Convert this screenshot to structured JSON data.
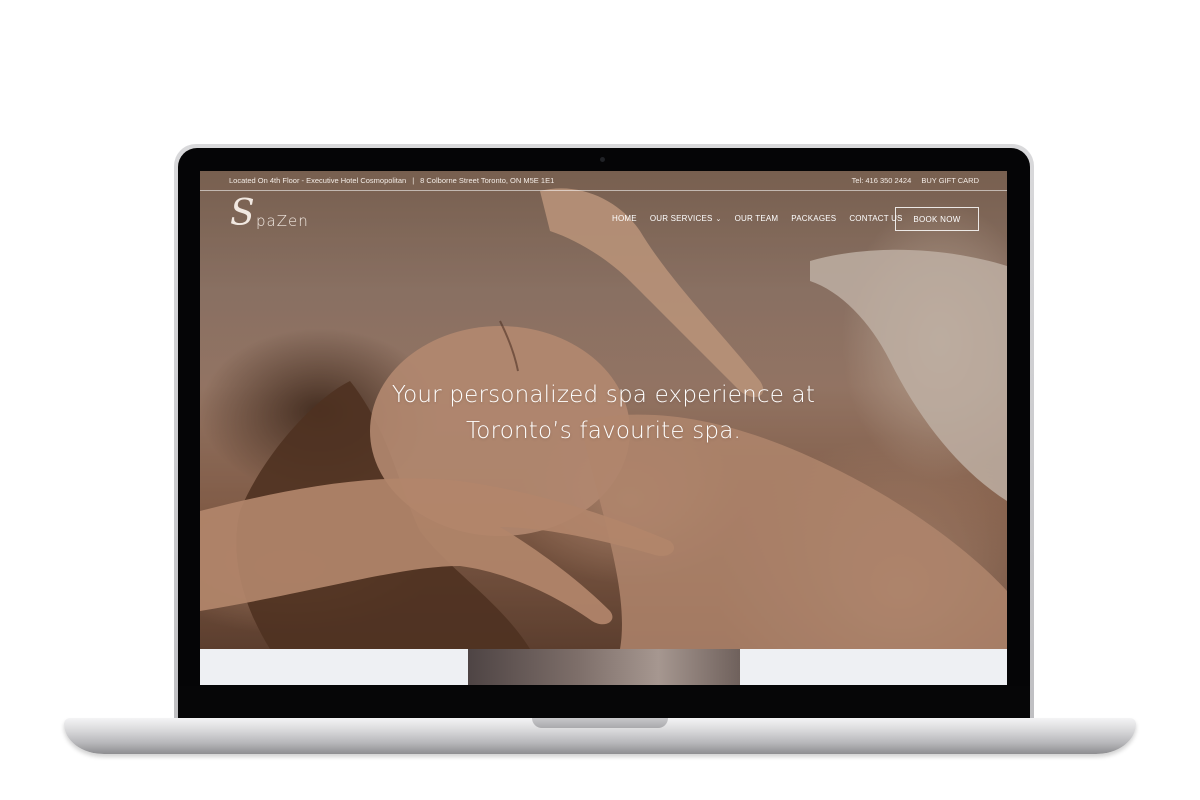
{
  "topbar": {
    "location": "Located On 4th Floor - Executive Hotel Cosmopolitan",
    "separator": "|",
    "address": "8 Colborne Street Toronto, ON M5E 1E1",
    "phone": "Tel: 416 350 2424",
    "gift_card": "BUY GIFT CARD"
  },
  "logo": {
    "s": "S",
    "word": "paZen"
  },
  "nav": {
    "items": [
      "HOME",
      "OUR SERVICES",
      "OUR TEAM",
      "PACKAGES",
      "CONTACT US"
    ],
    "services_chevron": "⌄",
    "book_button": "BOOK NOW"
  },
  "hero": {
    "headline_line1": "Your personalized spa experience at",
    "headline_line2": "Toronto’s favourite spa."
  },
  "colors": {
    "hero_overlay": "#8e7462",
    "strip": "#eef0f3",
    "text": "#ffffff"
  }
}
